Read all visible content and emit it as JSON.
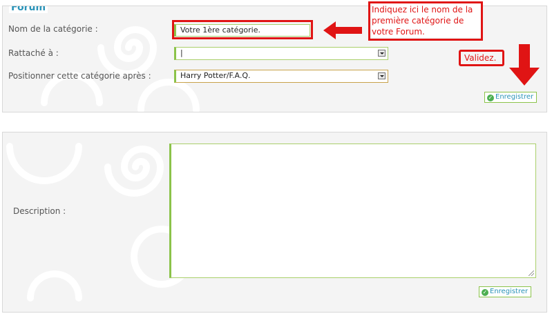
{
  "forum_section": {
    "legend": "Forum",
    "category_name_label": "Nom de la catégorie :",
    "category_name_value": "Votre 1ère catégorie.",
    "attached_to_label": "Rattaché à :",
    "attached_to_value": "|",
    "position_after_label": "Positionner cette catégorie après :",
    "position_after_value": "Harry Potter/F.A.Q.",
    "save_label": "Enregistrer"
  },
  "annotations": {
    "hint_text": "Indiquez ici le nom de la première catégorie de votre Forum.",
    "validate_text": "Validez.",
    "color": "#e01414"
  },
  "description_section": {
    "description_label": "Description :",
    "description_value": "",
    "save_label": "Enregistrer"
  },
  "colors": {
    "accent_green": "#8bc34a",
    "legend_blue": "#2a93b8",
    "panel_bg": "#f4f4f4"
  }
}
